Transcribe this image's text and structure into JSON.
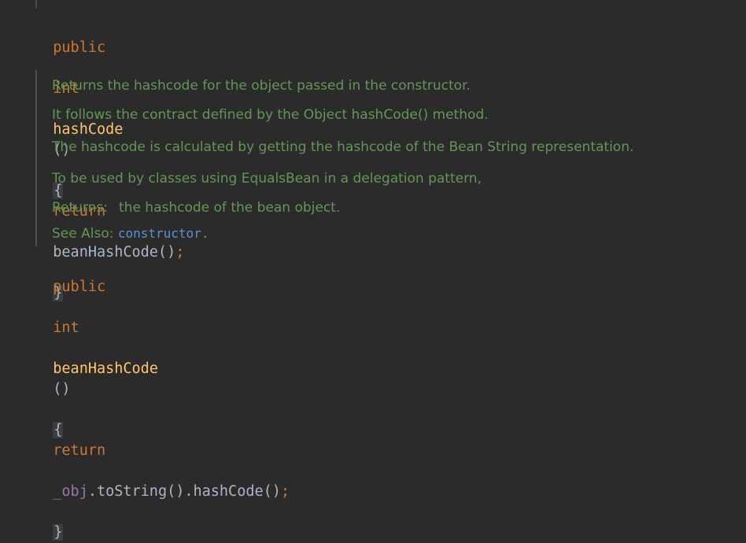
{
  "editor": {
    "line1": {
      "kw_public": "public",
      "kw_int": "int",
      "method": "hashCode",
      "parens": "()",
      "brace_open": "{",
      "kw_return": "return",
      "call": "beanHashCode();",
      "brace_close": "}"
    },
    "doc": {
      "lines": [
        "Returns the hashcode for the object passed in the constructor.",
        "It follows the contract defined by the Object hashCode() method.",
        "The hashcode is calculated by getting the hashcode of the Bean String representation.",
        "To be used by classes using EqualsBean in a delegation pattern,"
      ],
      "returns_label": "Returns:",
      "returns_text": "the hashcode of the bean object.",
      "see_also_label": "See Also:",
      "see_also_link": "constructor."
    },
    "line2": {
      "kw_public": "public",
      "kw_int": "int",
      "method": "beanHashCode",
      "parens": "()",
      "brace_open": "{",
      "kw_return": "return",
      "field": "_obj",
      "call": ".toString().hashCode();",
      "brace_close": "}"
    }
  }
}
